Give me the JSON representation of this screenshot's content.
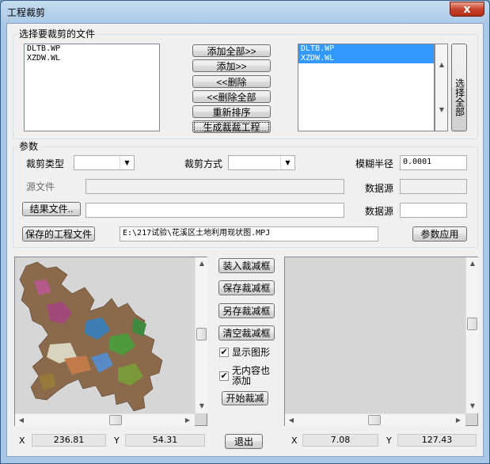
{
  "window": {
    "title": "工程裁剪",
    "close_label": "x"
  },
  "file_group": {
    "label": "选择要裁剪的文件",
    "source_files": [
      "DLTB.WP",
      "XZDW.WL"
    ],
    "selected_files": [
      "DLTB.WP",
      "XZDW.WL"
    ],
    "buttons": {
      "add_all": "添加全部>>",
      "add": "添加>>",
      "remove": "<<删除",
      "remove_all": "<<删除全部",
      "reorder": "重新排序",
      "generate": "生成裁裁工程"
    },
    "select_all_label": "选择全部"
  },
  "params": {
    "label": "参数",
    "clip_type_label": "裁剪类型",
    "clip_type_value": "",
    "clip_mode_label": "裁剪方式",
    "clip_mode_value": "",
    "fuzzy_radius_label": "模糊半径",
    "fuzzy_radius_value": "0.0001",
    "source_file_label": "源文件",
    "source_file_value": "",
    "datasource_label": "数据源",
    "datasource_value": "",
    "result_file_button": "结果文件..",
    "result_file_value": "",
    "result_datasource_label": "数据源",
    "result_datasource_value": "",
    "saved_project_button": "保存的工程文件",
    "saved_project_path": "E:\\217试验\\花溪区土地利用现状图.MPJ",
    "apply_button": "参数应用"
  },
  "controls": {
    "load_box": "装入裁减框",
    "save_box": "保存裁减框",
    "save_as_box": "另存裁减框",
    "clear_box": "清空裁减框",
    "show_graphics": "显示图形",
    "show_graphics_checked": true,
    "empty_add": "无内容也添加",
    "empty_add_checked": true,
    "start_clip": "开始裁减",
    "exit": "退出"
  },
  "left_coords": {
    "x_label": "X",
    "x_value": "236.81",
    "y_label": "Y",
    "y_value": "54.31"
  },
  "right_coords": {
    "x_label": "X",
    "x_value": "7.08",
    "y_label": "Y",
    "y_value": "127.43"
  },
  "colors": {
    "map_bg": "#d6d6d6",
    "selection": "#3399ff"
  }
}
